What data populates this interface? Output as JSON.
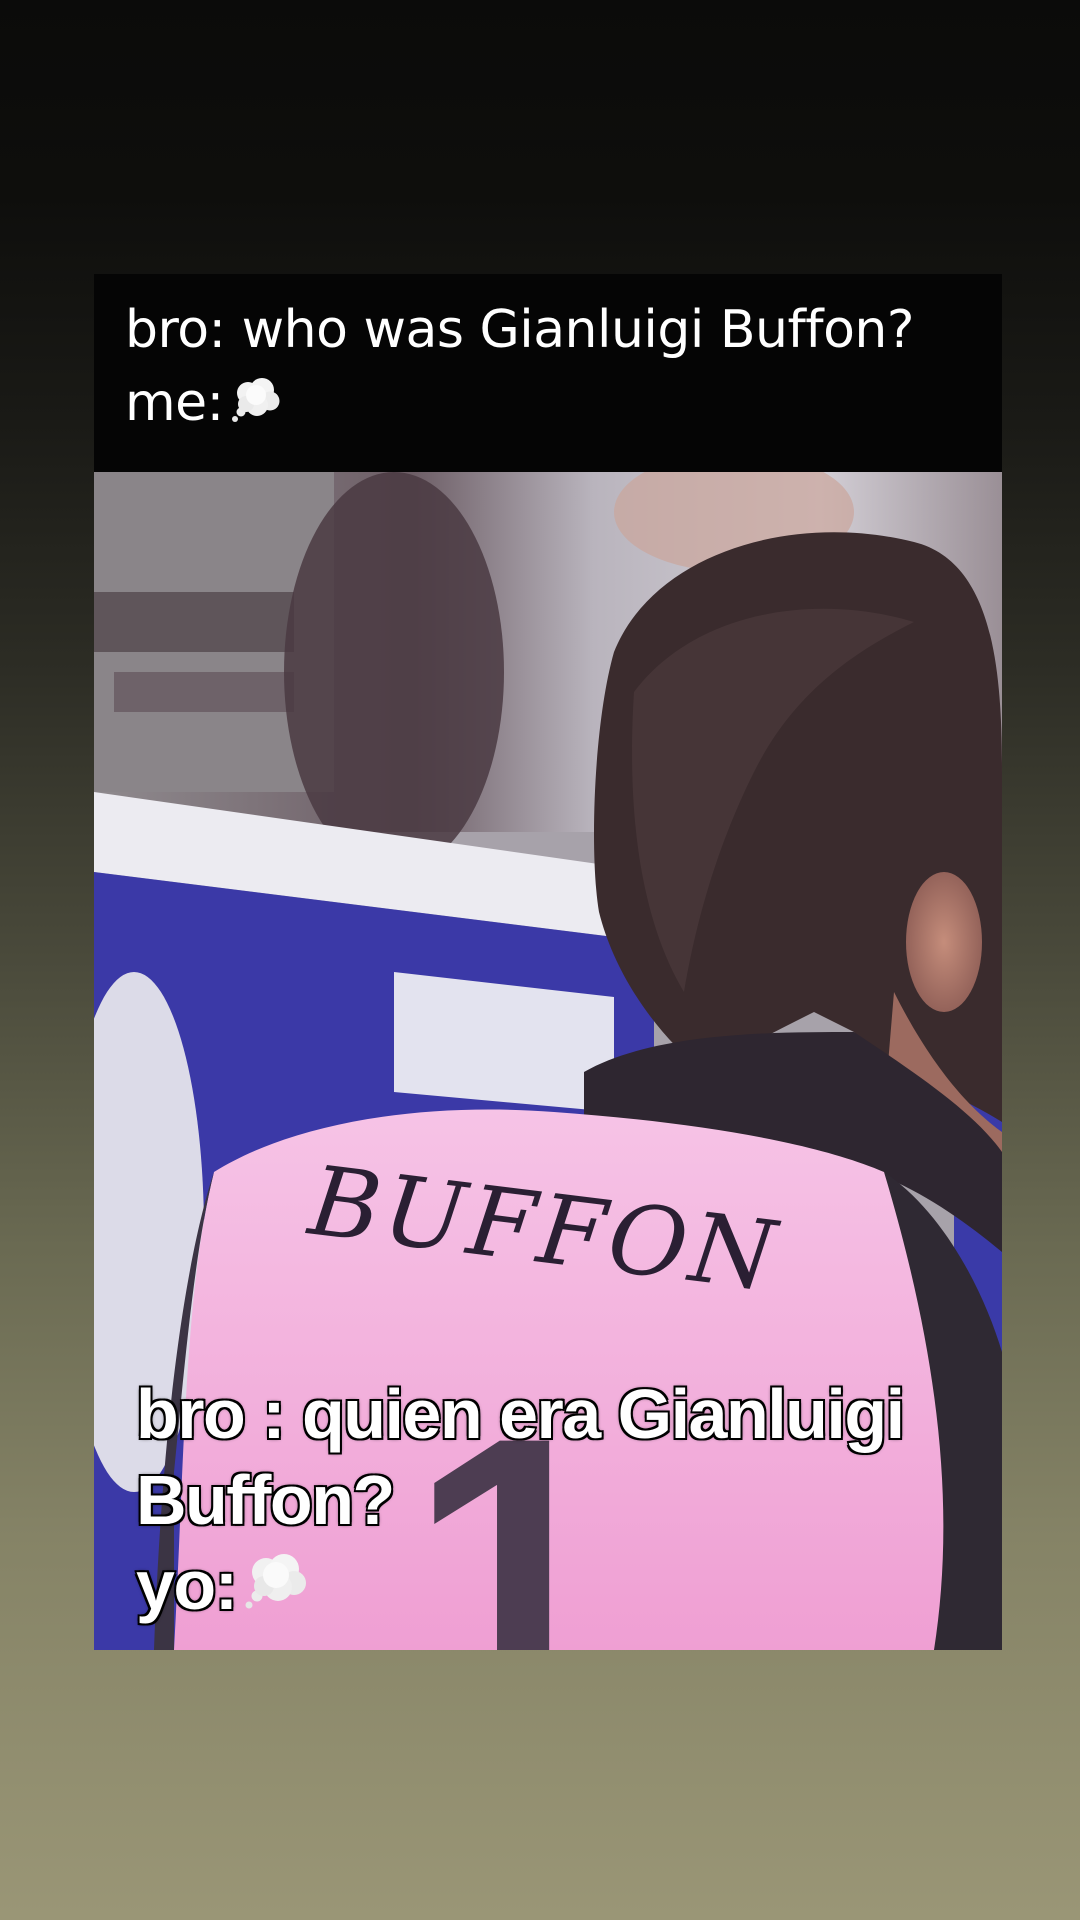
{
  "caption": {
    "line1": "bro: who was Gianluigi Buffon?",
    "line2_text": "me:",
    "line2_icon": "thought-balloon-emoji"
  },
  "photo": {
    "jersey_name": "BUFFON",
    "jersey_number": "1",
    "colors": {
      "jersey": "#f3b3de",
      "hair": "#3a2c2e",
      "board_blue": "#3c3aa6",
      "board_white": "#e9e8ef"
    }
  },
  "overlay": {
    "line1": "bro : quien era Gianluigi",
    "line2": "Buffon?",
    "line3_text": "yo:",
    "line3_icon": "thought-balloon-emoji"
  }
}
